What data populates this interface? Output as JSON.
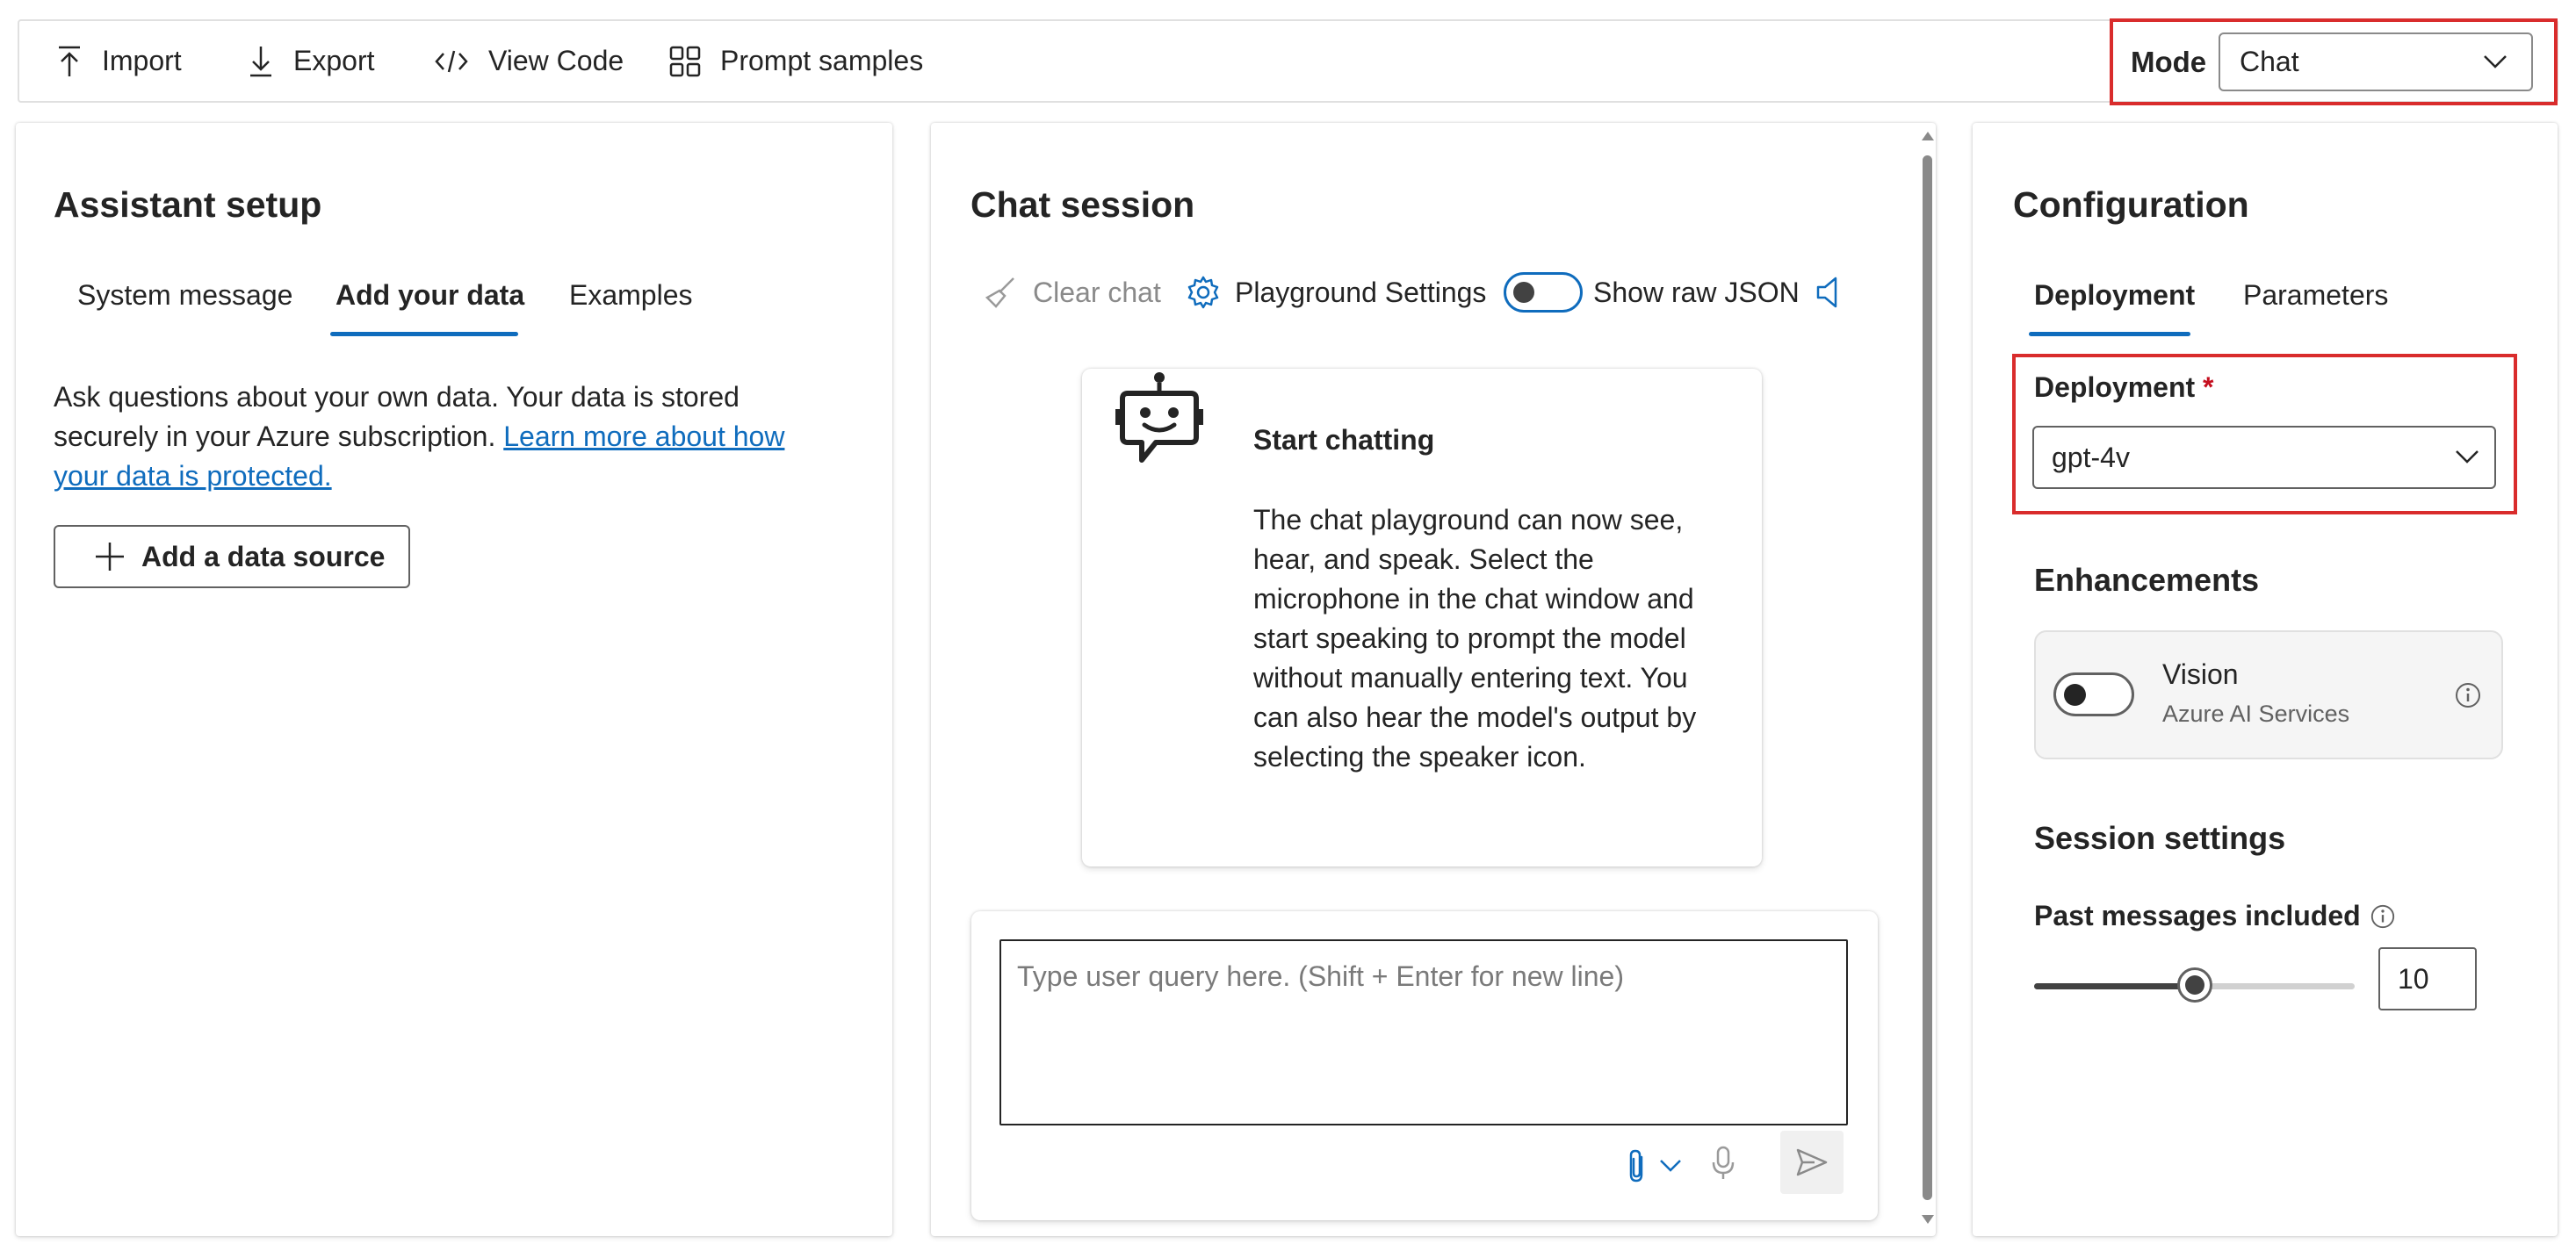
{
  "toolbar": {
    "import_label": "Import",
    "export_label": "Export",
    "view_code_label": "View Code",
    "prompt_samples_label": "Prompt samples",
    "mode_label": "Mode",
    "mode_value": "Chat"
  },
  "assistant_setup": {
    "title": "Assistant setup",
    "tabs": [
      {
        "label": "System message",
        "active": false
      },
      {
        "label": "Add your data",
        "active": true
      },
      {
        "label": "Examples",
        "active": false
      }
    ],
    "description": "Ask questions about your own data. Your data is stored securely in your Azure subscription.",
    "learn_more_link": "Learn more about how your data is protected.",
    "add_source_label": "Add a data source"
  },
  "chat_session": {
    "title": "Chat session",
    "clear_chat_label": "Clear chat",
    "playground_settings_label": "Playground Settings",
    "show_raw_json_label": "Show raw JSON",
    "show_raw_json_on": false,
    "start_title": "Start chatting",
    "start_body": "The chat playground can now see, hear, and speak. Select the microphone in the chat window and start speaking to prompt the model without manually entering text. You can also hear the model's output by selecting the speaker icon.",
    "query_placeholder": "Type user query here. (Shift + Enter for new line)"
  },
  "configuration": {
    "title": "Configuration",
    "tabs": [
      {
        "label": "Deployment",
        "active": true
      },
      {
        "label": "Parameters",
        "active": false
      }
    ],
    "deployment_label": "Deployment",
    "required_mark": "*",
    "deployment_value": "gpt-4v",
    "enhancements_title": "Enhancements",
    "vision_title": "Vision",
    "vision_subtitle": "Azure AI Services",
    "vision_on": false,
    "session_settings_title": "Session settings",
    "past_messages_label": "Past messages included",
    "past_messages_value": "10",
    "past_messages_fraction": 0.5
  },
  "colors": {
    "accent": "#0f6cbd",
    "highlight": "#d92c2c",
    "required": "#c50f1f"
  }
}
